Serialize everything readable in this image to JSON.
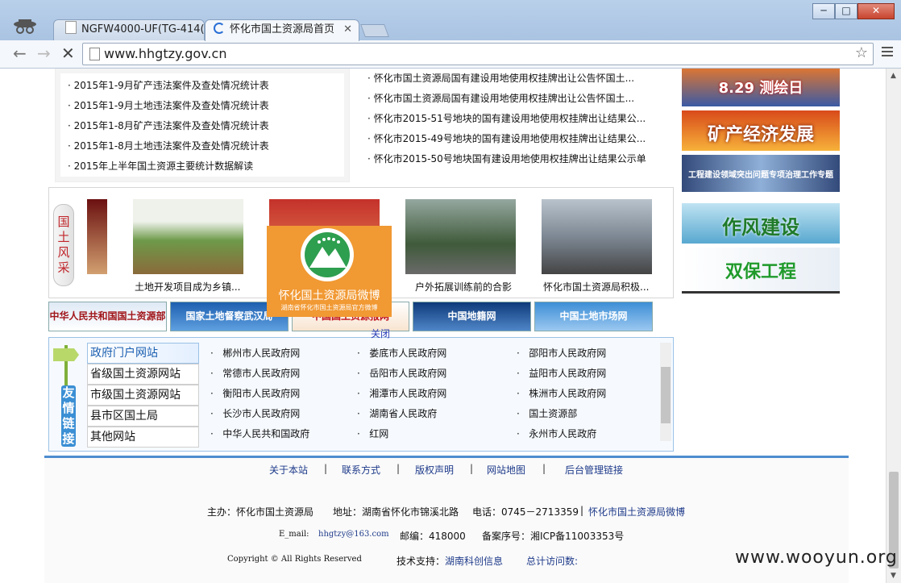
{
  "browser": {
    "tabs": [
      {
        "label": "NGFW4000-UF(TG-414("
      },
      {
        "label": "怀化市国土资源局首页"
      }
    ],
    "url": "www.hhgtzy.gov.cn",
    "window_buttons": {
      "minimize": "─",
      "maximize": "□",
      "close": "✕"
    }
  },
  "left_list": [
    "2015年1-9月矿产违法案件及查处情况统计表",
    "2015年1-9月土地违法案件及查处情况统计表",
    "2015年1-8月矿产违法案件及查处情况统计表",
    "2015年1-8月土地违法案件及查处情况统计表",
    "2015年上半年国土资源主要统计数据解读"
  ],
  "right_list": [
    "怀化市国土资源局国有建设用地使用权挂牌出让公告怀国土...",
    "怀化市国土资源局国有建设用地使用权挂牌出让公告怀国土...",
    "怀化市2015-51号地块的国有建设用地使用权挂牌出让结果公...",
    "怀化市2015-49号地块的国有建设用地使用权挂牌出让结果公...",
    "怀化市2015-50号地块国有建设用地使用权挂牌出让结果公示单"
  ],
  "side_banners": [
    "8.29 测绘日",
    "矿产经济发展",
    "工程建设领域突出问题专项治理工作专题",
    "作风建设",
    "双保工程"
  ],
  "gallery": {
    "tag": [
      "国",
      "土",
      "风",
      "采"
    ],
    "captions": [
      "土地开发项目成为乡镇...",
      "",
      "户外拓展训练前的合影",
      "怀化市国土资源局积极..."
    ]
  },
  "weibo": {
    "title": "怀化国土资源局微博",
    "subtitle": "湖南省怀化市国土资源局官方微博",
    "close": "关闭"
  },
  "link_banners": [
    "中华人民共和国国土资源部",
    "国家土地督察武汉局",
    "中国国土资源报网",
    "中国地籍网",
    "中国土地市场网"
  ],
  "friend_links": {
    "side_title": [
      "友",
      "情",
      "链",
      "接"
    ],
    "tabs": [
      "政府门户网站",
      "省级国土资源网站",
      "市级国土资源网站",
      "县市区国土局",
      "其他网站"
    ],
    "cells": [
      [
        "郴州市人民政府网",
        "娄底市人民政府网",
        "邵阳市人民政府网"
      ],
      [
        "常德市人民政府网",
        "岳阳市人民政府网",
        "益阳市人民政府网"
      ],
      [
        "衡阳市人民政府网",
        "湘潭市人民政府网",
        "株洲市人民政府网"
      ],
      [
        "长沙市人民政府网",
        "湖南省人民政府",
        "国土资源部"
      ],
      [
        "中华人民共和国政府",
        "红网",
        "永州市人民政府"
      ]
    ]
  },
  "footer": {
    "nav": [
      "关于本站",
      "联系方式",
      "版权声明",
      "网站地图",
      "后台管理链接"
    ],
    "sep": "|",
    "sponsor": "主办：怀化市国土资源局",
    "address": "地址：湖南省怀化市锦溪北路",
    "phone": "电话：0745－2713359",
    "weibo_link": "怀化市国土资源局微博",
    "email_label": "E_mail:",
    "email": "hhgtzy@163.com",
    "postcode": "邮编：418000",
    "icp": "备案序号：湘ICP备11003353号",
    "copyright": "Copyright © All Rights Reserved",
    "tech_label": "技术支持：",
    "tech": "湖南科创信息",
    "visits": "总计访问数:"
  },
  "watermark": "www.wooyun.org",
  "colors": {
    "accent": "#1e3a8a",
    "footer_line": "#4e8dcf",
    "tag_red": "#c0252a"
  }
}
